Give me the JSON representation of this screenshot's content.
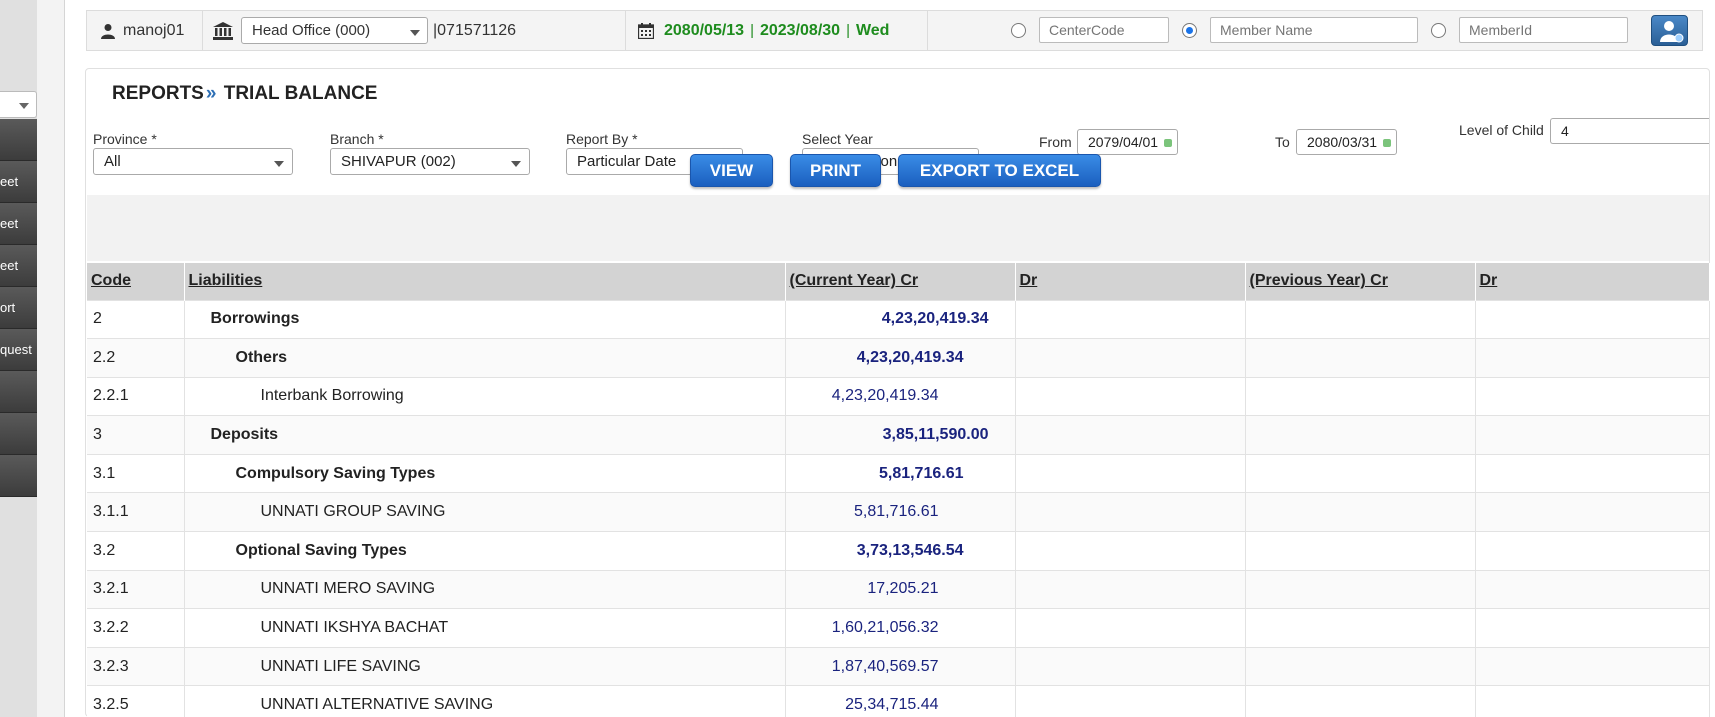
{
  "sidebar": {
    "select_value": "",
    "items": [
      "",
      "eet",
      "eet",
      "eet",
      "ort",
      "quest",
      "",
      "",
      ""
    ]
  },
  "topbar": {
    "username": "manoj01",
    "branch_select": "Head Office (000)",
    "phone": "|071571126",
    "date_bs": "2080/05/13",
    "date_ad": "2023/08/30",
    "weekday": "Wed",
    "date_sep": "|",
    "search": {
      "centercode_placeholder": "CenterCode",
      "membername_placeholder": "Member Name",
      "memberid_placeholder": "MemberId",
      "selected": "member_name"
    }
  },
  "page": {
    "title_section": "REPORTS",
    "title_sep": "»",
    "title_page": "TRIAL BALANCE"
  },
  "filters": {
    "province_label": "Province *",
    "province_value": "All",
    "branch_label": "Branch *",
    "branch_value": "SHIVAPUR (002)",
    "report_by_label": "Report By *",
    "report_by_value": "Particular Date",
    "select_year_label": "Select Year",
    "select_year_value": "Comparision",
    "from_label": "From",
    "from_value": "2079/04/01",
    "to_label": "To",
    "to_value": "2080/03/31",
    "level_label": "Level of Child",
    "level_value": "4"
  },
  "buttons": {
    "view": "VIEW",
    "print": "PRINT",
    "export": "EXPORT TO EXCEL"
  },
  "table": {
    "headers": [
      "Code",
      "Liabilities",
      "(Current Year) Cr",
      "Dr",
      "(Previous Year) Cr",
      "Dr"
    ],
    "rows": [
      {
        "code": "2",
        "name": "Borrowings",
        "level": 1,
        "cur_cr": "4,23,20,419.34",
        "cur_dr": "",
        "prev_cr": "",
        "prev_dr": ""
      },
      {
        "code": "2.2",
        "name": "Others",
        "level": 2,
        "cur_cr": "4,23,20,419.34",
        "cur_dr": "",
        "prev_cr": "",
        "prev_dr": ""
      },
      {
        "code": "2.2.1",
        "name": "Interbank Borrowing",
        "level": 3,
        "cur_cr": "4,23,20,419.34",
        "cur_dr": "",
        "prev_cr": "",
        "prev_dr": ""
      },
      {
        "code": "3",
        "name": "Deposits",
        "level": 1,
        "cur_cr": "3,85,11,590.00",
        "cur_dr": "",
        "prev_cr": "",
        "prev_dr": ""
      },
      {
        "code": "3.1",
        "name": "Compulsory Saving Types",
        "level": 2,
        "cur_cr": "5,81,716.61",
        "cur_dr": "",
        "prev_cr": "",
        "prev_dr": ""
      },
      {
        "code": "3.1.1",
        "name": "UNNATI GROUP SAVING",
        "level": 3,
        "cur_cr": "5,81,716.61",
        "cur_dr": "",
        "prev_cr": "",
        "prev_dr": ""
      },
      {
        "code": "3.2",
        "name": "Optional Saving Types",
        "level": 2,
        "cur_cr": "3,73,13,546.54",
        "cur_dr": "",
        "prev_cr": "",
        "prev_dr": ""
      },
      {
        "code": "3.2.1",
        "name": "UNNATI MERO SAVING",
        "level": 3,
        "cur_cr": "17,205.21",
        "cur_dr": "",
        "prev_cr": "",
        "prev_dr": ""
      },
      {
        "code": "3.2.2",
        "name": "UNNATI IKSHYA BACHAT",
        "level": 3,
        "cur_cr": "1,60,21,056.32",
        "cur_dr": "",
        "prev_cr": "",
        "prev_dr": ""
      },
      {
        "code": "3.2.3",
        "name": "UNNATI LIFE SAVING",
        "level": 3,
        "cur_cr": "1,87,40,569.57",
        "cur_dr": "",
        "prev_cr": "",
        "prev_dr": ""
      },
      {
        "code": "3.2.5",
        "name": "UNNATI ALTERNATIVE SAVING",
        "level": 3,
        "cur_cr": "25,34,715.44",
        "cur_dr": "",
        "prev_cr": "",
        "prev_dr": ""
      }
    ]
  },
  "colors": {
    "accent_blue": "#1b5fbf",
    "date_green": "#1e8c1e",
    "amount_navy": "#1a237e",
    "header_gray": "#d3d3d3"
  }
}
